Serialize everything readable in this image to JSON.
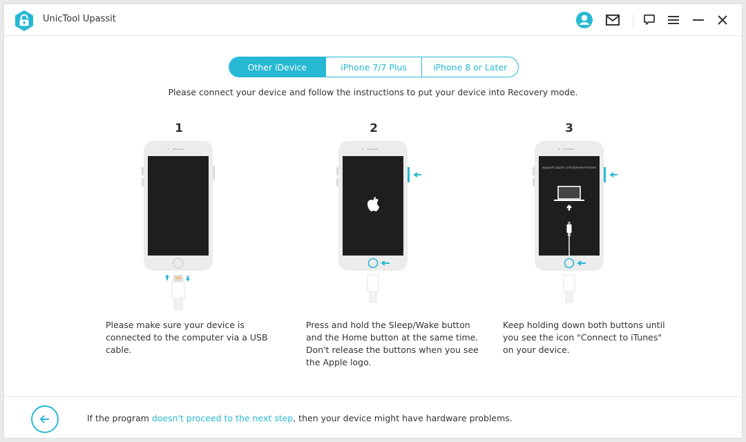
{
  "app": {
    "title": "UnicTool Upassit",
    "accent_color": "#27b8d3"
  },
  "titlebar": {
    "icons": [
      "user-account-icon",
      "mail-icon",
      "feedback-icon",
      "menu-icon",
      "minimize-icon",
      "close-icon"
    ]
  },
  "tabs": [
    {
      "label": "Other iDevice",
      "active": true
    },
    {
      "label": "iPhone 7/7 Plus",
      "active": false
    },
    {
      "label": "iPhone 8 or Later",
      "active": false
    }
  ],
  "instruction": "Please connect your device and follow the instructions to put your device into Recovery mode.",
  "steps": [
    {
      "number": "1",
      "description": "Please make sure your device is connected to the computer via a USB cable."
    },
    {
      "number": "2",
      "description": "Press and hold the Sleep/Wake button and the Home button at the same time. Don't release the buttons when you see the Apple logo."
    },
    {
      "number": "3",
      "description": "Keep holding down both buttons until you see the icon \"Connect to iTunes\" on your device.",
      "screen_url_text": "support.apple.com/iphone/restore"
    }
  ],
  "footer": {
    "text_before": "If the program ",
    "link": "doesn't proceed to the next step",
    "text_after": ", then your device might have hardware problems."
  }
}
